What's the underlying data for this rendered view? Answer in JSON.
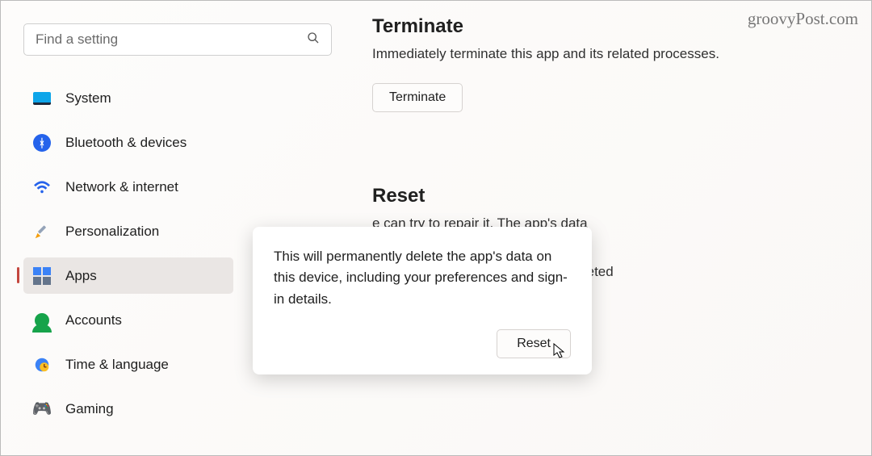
{
  "watermark": "groovyPost.com",
  "search": {
    "placeholder": "Find a setting"
  },
  "sidebar": {
    "items": [
      {
        "label": "System"
      },
      {
        "label": "Bluetooth & devices"
      },
      {
        "label": "Network & internet"
      },
      {
        "label": "Personalization"
      },
      {
        "label": "Apps"
      },
      {
        "label": "Accounts"
      },
      {
        "label": "Time & language"
      },
      {
        "label": "Gaming"
      }
    ]
  },
  "main": {
    "terminate": {
      "heading": "Terminate",
      "desc": "Immediately terminate this app and its related processes.",
      "button": "Terminate"
    },
    "reset": {
      "heading": "Reset",
      "repair_desc_fragment": "e can try to repair it. The app's data",
      "reset_desc_fragment": "t, reset it. The app's data will be deleted",
      "button": "Reset"
    }
  },
  "tooltip": {
    "text": "This will permanently delete the app's data on this device, including your preferences and sign-in details.",
    "button": "Reset"
  }
}
